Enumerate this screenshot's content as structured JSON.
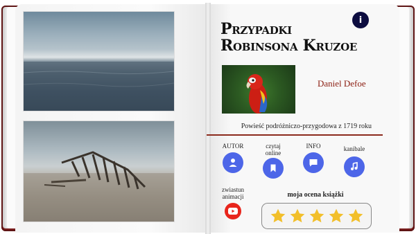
{
  "book": {
    "title_line1": "Przypadki",
    "title_line2": "Robinsona Kruzoe",
    "author": "Daniel Defoe",
    "genre": "Powieść podróżniczo-przygodowa z 1719 roku"
  },
  "info_button": {
    "label": "i"
  },
  "menu": [
    {
      "label": "AUTOR",
      "icon": "person-icon"
    },
    {
      "label": "czytaj online",
      "icon": "bookmark-icon"
    },
    {
      "label": "INFO",
      "icon": "chat-icon"
    },
    {
      "label": "kanibale",
      "icon": "music-note-icon"
    },
    {
      "label": "zwiastun animacji",
      "icon": "youtube-icon"
    }
  ],
  "rating": {
    "label": "moja ocena książki",
    "stars": 5,
    "max": 5
  },
  "colors": {
    "cover": "#7a1e1e",
    "accent": "#4d66e8",
    "author": "#8b1d10",
    "info": "#0d0d40",
    "youtube": "#e8251c",
    "star": "#f2bf2a"
  }
}
